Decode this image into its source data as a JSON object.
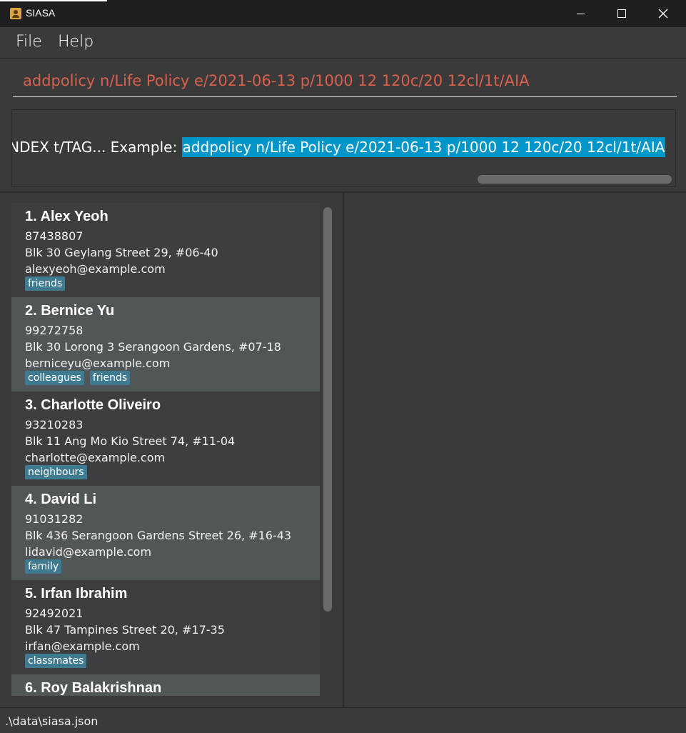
{
  "window": {
    "title": "SIASA",
    "app_icon": "contacts-book-icon",
    "controls": [
      "minimize-icon",
      "maximize-icon",
      "close-icon"
    ]
  },
  "menu": {
    "file": "File",
    "help": "Help"
  },
  "command": {
    "value": "addpolicy n/Life Policy e/2021-06-13 p/1000 12 120c/20 12cl/1t/AIA"
  },
  "result": {
    "prefix": "T_INDEX t/TAG... Example: ",
    "highlighted": "addpolicy n/Life Policy e/2021-06-13 p/1000 12 120c/20 12cl/1t/AIA"
  },
  "persons": [
    {
      "name": "1.  Alex Yeoh",
      "phone": "87438807",
      "address": "Blk 30 Geylang Street 29, #06-40",
      "email": "alexyeoh@example.com",
      "tags": [
        "friends"
      ]
    },
    {
      "name": "2.  Bernice Yu",
      "phone": "99272758",
      "address": "Blk 30 Lorong 3 Serangoon Gardens, #07-18",
      "email": "berniceyu@example.com",
      "tags": [
        "colleagues",
        "friends"
      ]
    },
    {
      "name": "3.  Charlotte Oliveiro",
      "phone": "93210283",
      "address": "Blk 11 Ang Mo Kio Street 74, #11-04",
      "email": "charlotte@example.com",
      "tags": [
        "neighbours"
      ]
    },
    {
      "name": "4.  David Li",
      "phone": "91031282",
      "address": "Blk 436 Serangoon Gardens Street 26, #16-43",
      "email": "lidavid@example.com",
      "tags": [
        "family"
      ]
    },
    {
      "name": "5.  Irfan Ibrahim",
      "phone": "92492021",
      "address": "Blk 47 Tampines Street 20, #17-35",
      "email": "irfan@example.com",
      "tags": [
        "classmates"
      ]
    },
    {
      "name": "6.  Roy Balakrishnan",
      "phone": "",
      "address": "",
      "email": "",
      "tags": []
    }
  ],
  "status": {
    "path": ".\\data\\siasa.json"
  },
  "colors": {
    "background": "#3a3a3a",
    "titlebar": "#1f1f1f",
    "command_text": "#d9604c",
    "highlight": "#0096c9",
    "card_odd": "#3c3e3f",
    "card_even": "#515658",
    "tag": "#3e7b91"
  }
}
